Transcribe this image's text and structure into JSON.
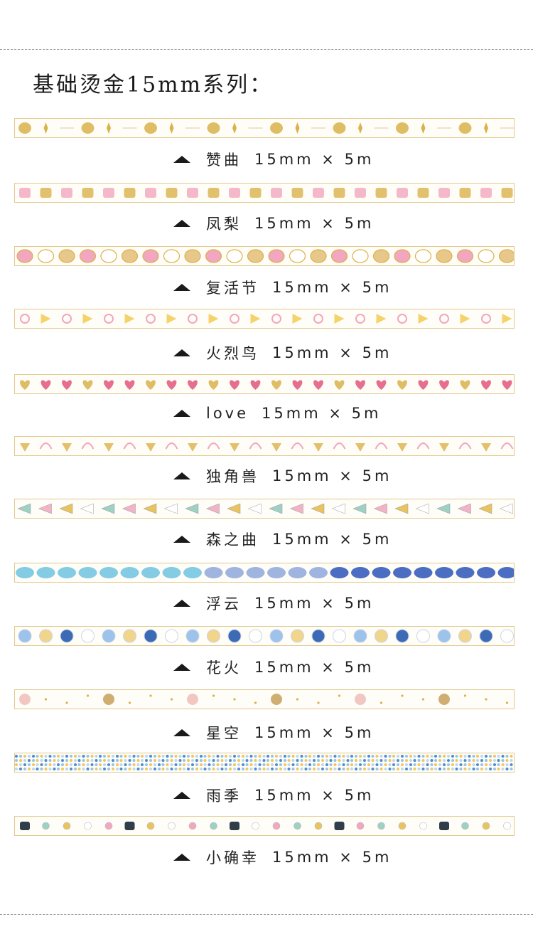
{
  "title": "基础烫金15mm系列：",
  "tapes": [
    {
      "name": "赞曲",
      "spec": "15mm × 5m"
    },
    {
      "name": "凤梨",
      "spec": "15mm × 5m"
    },
    {
      "name": "复活节",
      "spec": "15mm × 5m"
    },
    {
      "name": "火烈鸟",
      "spec": "15mm × 5m"
    },
    {
      "name": "love",
      "spec": "15mm × 5m"
    },
    {
      "name": "独角兽",
      "spec": "15mm × 5m"
    },
    {
      "name": "森之曲",
      "spec": "15mm × 5m"
    },
    {
      "name": "浮云",
      "spec": "15mm × 5m"
    },
    {
      "name": "花火",
      "spec": "15mm × 5m"
    },
    {
      "name": "星空",
      "spec": "15mm × 5m"
    },
    {
      "name": "雨季",
      "spec": "15mm × 5m"
    },
    {
      "name": "小确幸",
      "spec": "15mm × 5m"
    }
  ],
  "patterns": [
    "gold-ornament",
    "pineapple",
    "eggs",
    "flamingo",
    "hearts",
    "unicorn",
    "trees",
    "clouds",
    "fireworks-dots",
    "star-constellation",
    "rain-dots",
    "small-icons"
  ],
  "colors": {
    "gold": "#d9b24a",
    "pink": "#f2a6bf",
    "blue": "#4f8ccd",
    "border": "#e2c98f"
  }
}
